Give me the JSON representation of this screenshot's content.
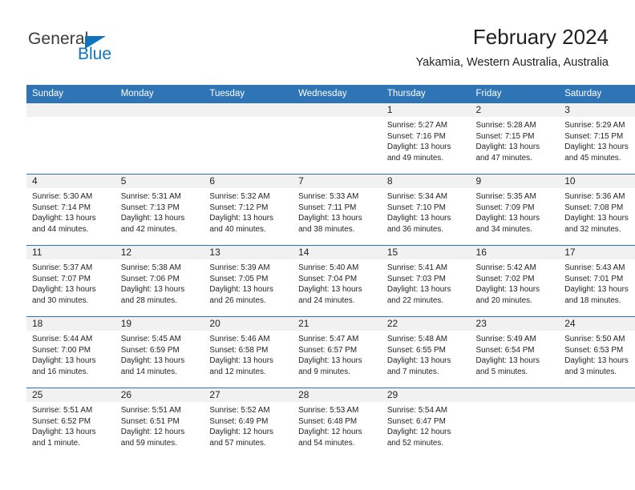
{
  "logo": {
    "word1": "General",
    "word2": "Blue",
    "triangle_color": "#1273bd"
  },
  "header": {
    "title": "February 2024",
    "subtitle": "Yakamia, Western Australia, Australia"
  },
  "theme": {
    "header_blue": "#2f74b5",
    "daynum_band": "#f1f1f1",
    "text": "#231f20"
  },
  "weekday_headers": [
    "Sunday",
    "Monday",
    "Tuesday",
    "Wednesday",
    "Thursday",
    "Friday",
    "Saturday"
  ],
  "weeks": [
    [
      {
        "day": "",
        "lines": []
      },
      {
        "day": "",
        "lines": []
      },
      {
        "day": "",
        "lines": []
      },
      {
        "day": "",
        "lines": []
      },
      {
        "day": "1",
        "lines": [
          "Sunrise: 5:27 AM",
          "Sunset: 7:16 PM",
          "Daylight: 13 hours",
          "and 49 minutes."
        ]
      },
      {
        "day": "2",
        "lines": [
          "Sunrise: 5:28 AM",
          "Sunset: 7:15 PM",
          "Daylight: 13 hours",
          "and 47 minutes."
        ]
      },
      {
        "day": "3",
        "lines": [
          "Sunrise: 5:29 AM",
          "Sunset: 7:15 PM",
          "Daylight: 13 hours",
          "and 45 minutes."
        ]
      }
    ],
    [
      {
        "day": "4",
        "lines": [
          "Sunrise: 5:30 AM",
          "Sunset: 7:14 PM",
          "Daylight: 13 hours",
          "and 44 minutes."
        ]
      },
      {
        "day": "5",
        "lines": [
          "Sunrise: 5:31 AM",
          "Sunset: 7:13 PM",
          "Daylight: 13 hours",
          "and 42 minutes."
        ]
      },
      {
        "day": "6",
        "lines": [
          "Sunrise: 5:32 AM",
          "Sunset: 7:12 PM",
          "Daylight: 13 hours",
          "and 40 minutes."
        ]
      },
      {
        "day": "7",
        "lines": [
          "Sunrise: 5:33 AM",
          "Sunset: 7:11 PM",
          "Daylight: 13 hours",
          "and 38 minutes."
        ]
      },
      {
        "day": "8",
        "lines": [
          "Sunrise: 5:34 AM",
          "Sunset: 7:10 PM",
          "Daylight: 13 hours",
          "and 36 minutes."
        ]
      },
      {
        "day": "9",
        "lines": [
          "Sunrise: 5:35 AM",
          "Sunset: 7:09 PM",
          "Daylight: 13 hours",
          "and 34 minutes."
        ]
      },
      {
        "day": "10",
        "lines": [
          "Sunrise: 5:36 AM",
          "Sunset: 7:08 PM",
          "Daylight: 13 hours",
          "and 32 minutes."
        ]
      }
    ],
    [
      {
        "day": "11",
        "lines": [
          "Sunrise: 5:37 AM",
          "Sunset: 7:07 PM",
          "Daylight: 13 hours",
          "and 30 minutes."
        ]
      },
      {
        "day": "12",
        "lines": [
          "Sunrise: 5:38 AM",
          "Sunset: 7:06 PM",
          "Daylight: 13 hours",
          "and 28 minutes."
        ]
      },
      {
        "day": "13",
        "lines": [
          "Sunrise: 5:39 AM",
          "Sunset: 7:05 PM",
          "Daylight: 13 hours",
          "and 26 minutes."
        ]
      },
      {
        "day": "14",
        "lines": [
          "Sunrise: 5:40 AM",
          "Sunset: 7:04 PM",
          "Daylight: 13 hours",
          "and 24 minutes."
        ]
      },
      {
        "day": "15",
        "lines": [
          "Sunrise: 5:41 AM",
          "Sunset: 7:03 PM",
          "Daylight: 13 hours",
          "and 22 minutes."
        ]
      },
      {
        "day": "16",
        "lines": [
          "Sunrise: 5:42 AM",
          "Sunset: 7:02 PM",
          "Daylight: 13 hours",
          "and 20 minutes."
        ]
      },
      {
        "day": "17",
        "lines": [
          "Sunrise: 5:43 AM",
          "Sunset: 7:01 PM",
          "Daylight: 13 hours",
          "and 18 minutes."
        ]
      }
    ],
    [
      {
        "day": "18",
        "lines": [
          "Sunrise: 5:44 AM",
          "Sunset: 7:00 PM",
          "Daylight: 13 hours",
          "and 16 minutes."
        ]
      },
      {
        "day": "19",
        "lines": [
          "Sunrise: 5:45 AM",
          "Sunset: 6:59 PM",
          "Daylight: 13 hours",
          "and 14 minutes."
        ]
      },
      {
        "day": "20",
        "lines": [
          "Sunrise: 5:46 AM",
          "Sunset: 6:58 PM",
          "Daylight: 13 hours",
          "and 12 minutes."
        ]
      },
      {
        "day": "21",
        "lines": [
          "Sunrise: 5:47 AM",
          "Sunset: 6:57 PM",
          "Daylight: 13 hours",
          "and 9 minutes."
        ]
      },
      {
        "day": "22",
        "lines": [
          "Sunrise: 5:48 AM",
          "Sunset: 6:55 PM",
          "Daylight: 13 hours",
          "and 7 minutes."
        ]
      },
      {
        "day": "23",
        "lines": [
          "Sunrise: 5:49 AM",
          "Sunset: 6:54 PM",
          "Daylight: 13 hours",
          "and 5 minutes."
        ]
      },
      {
        "day": "24",
        "lines": [
          "Sunrise: 5:50 AM",
          "Sunset: 6:53 PM",
          "Daylight: 13 hours",
          "and 3 minutes."
        ]
      }
    ],
    [
      {
        "day": "25",
        "lines": [
          "Sunrise: 5:51 AM",
          "Sunset: 6:52 PM",
          "Daylight: 13 hours",
          "and 1 minute."
        ]
      },
      {
        "day": "26",
        "lines": [
          "Sunrise: 5:51 AM",
          "Sunset: 6:51 PM",
          "Daylight: 12 hours",
          "and 59 minutes."
        ]
      },
      {
        "day": "27",
        "lines": [
          "Sunrise: 5:52 AM",
          "Sunset: 6:49 PM",
          "Daylight: 12 hours",
          "and 57 minutes."
        ]
      },
      {
        "day": "28",
        "lines": [
          "Sunrise: 5:53 AM",
          "Sunset: 6:48 PM",
          "Daylight: 12 hours",
          "and 54 minutes."
        ]
      },
      {
        "day": "29",
        "lines": [
          "Sunrise: 5:54 AM",
          "Sunset: 6:47 PM",
          "Daylight: 12 hours",
          "and 52 minutes."
        ]
      },
      {
        "day": "",
        "lines": []
      },
      {
        "day": "",
        "lines": []
      }
    ]
  ]
}
